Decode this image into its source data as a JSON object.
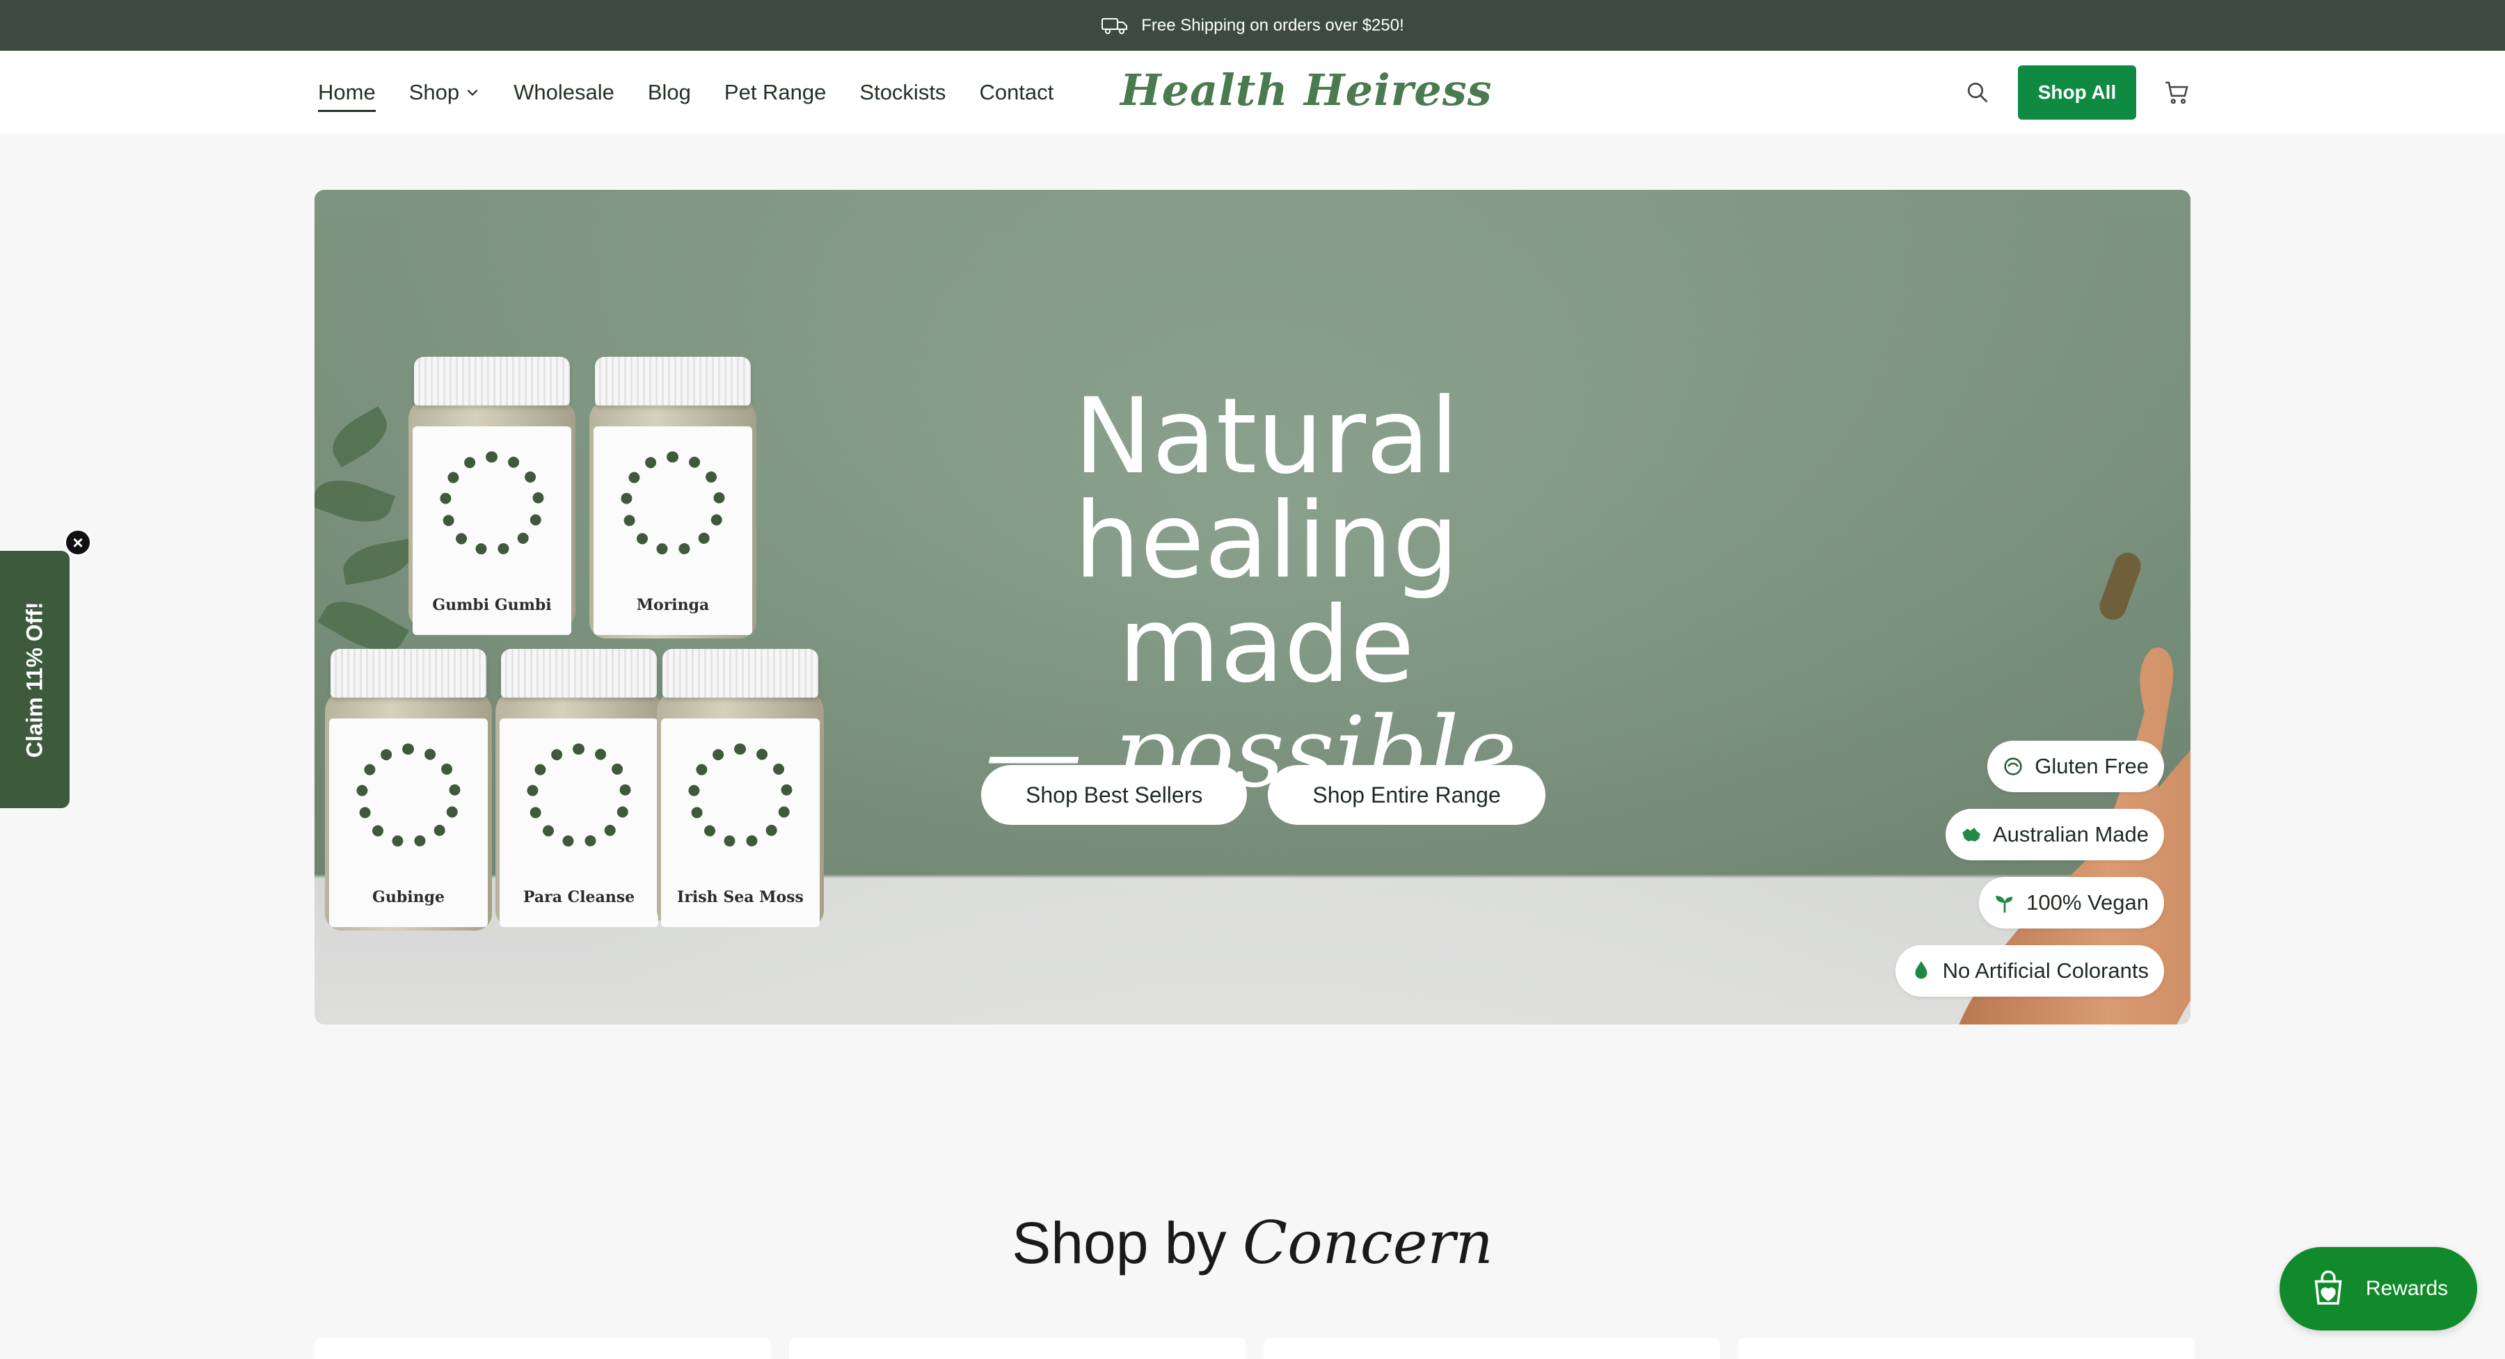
{
  "announcement": {
    "text": "Free Shipping on orders over $250!",
    "icon": "truck-icon"
  },
  "header": {
    "nav": [
      {
        "label": "Home",
        "active": true
      },
      {
        "label": "Shop",
        "has_dropdown": true
      },
      {
        "label": "Wholesale"
      },
      {
        "label": "Blog"
      },
      {
        "label": "Pet Range"
      },
      {
        "label": "Stockists"
      },
      {
        "label": "Contact"
      }
    ],
    "logo": "Health Heiress",
    "shop_all_label": "Shop All",
    "icons": [
      "search-icon",
      "cart-icon"
    ]
  },
  "hero": {
    "title_line1": "Natural",
    "title_line2": "healing made",
    "title_line3": "— possible.",
    "primary_button": "Shop Best Sellers",
    "secondary_button": "Shop Entire Range",
    "jars": [
      "Gumbi Gumbi",
      "Moringa",
      "Gubinge",
      "Para Cleanse",
      "Irish Sea Moss"
    ],
    "badges": [
      {
        "label": "Gluten Free",
        "icon": "gluten-free-icon"
      },
      {
        "label": "Australian Made",
        "icon": "australia-map-icon"
      },
      {
        "label": "100% Vegan",
        "icon": "sprout-icon"
      },
      {
        "label": "No Artificial Colorants",
        "icon": "droplet-icon"
      }
    ]
  },
  "side_tab": {
    "label": "Claim 11% Off!",
    "close": "×"
  },
  "section": {
    "title_plain": "Shop by ",
    "title_italic": "Concern"
  },
  "rewards": {
    "label": "Rewards",
    "icon": "shopping-bag-heart-icon"
  },
  "colors": {
    "brand_green": "#0f8a43",
    "announce_bg": "#3d4a3f",
    "rewards_green": "#108a2a",
    "side_tab": "#3d5a3d"
  }
}
